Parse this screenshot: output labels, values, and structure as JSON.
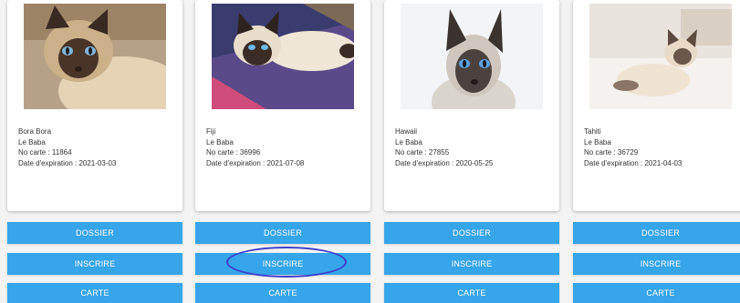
{
  "cards": [
    {
      "name": "Bora Bora",
      "breed": "Le Baba",
      "card_number": "No carte : 11864",
      "expiration": "Date d'expiration : 2021-03-03",
      "buttons": {
        "dossier": "DOSSIER",
        "inscrire": "INSCRIRE",
        "carte": "CARTE"
      }
    },
    {
      "name": "Fiji",
      "breed": "Le Baba",
      "card_number": "No carte : 36996",
      "expiration": "Date d'expiration : 2021-07-08",
      "buttons": {
        "dossier": "DOSSIER",
        "inscrire": "INSCRIRE",
        "carte": "CARTE"
      }
    },
    {
      "name": "Hawaii",
      "breed": "Le Baba",
      "card_number": "No carte : 27855",
      "expiration": "Date d'expiration : 2020-05-25",
      "buttons": {
        "dossier": "DOSSIER",
        "inscrire": "INSCRIRE",
        "carte": "CARTE"
      }
    },
    {
      "name": "Tahiti",
      "breed": "Le Baba",
      "card_number": "No carte : 36729",
      "expiration": "Date d'expiration : 2021-04-03",
      "buttons": {
        "dossier": "DOSSIER",
        "inscrire": "INSCRIRE",
        "carte": "CARTE"
      }
    }
  ],
  "colors": {
    "button": "#36a5ea",
    "button_text": "#ffffff",
    "card_bg": "#ffffff",
    "page_bg": "#f3f3f3",
    "annotation_ellipse": "#3b3fc9"
  },
  "icons": [
    "siamese-cat-photo"
  ]
}
